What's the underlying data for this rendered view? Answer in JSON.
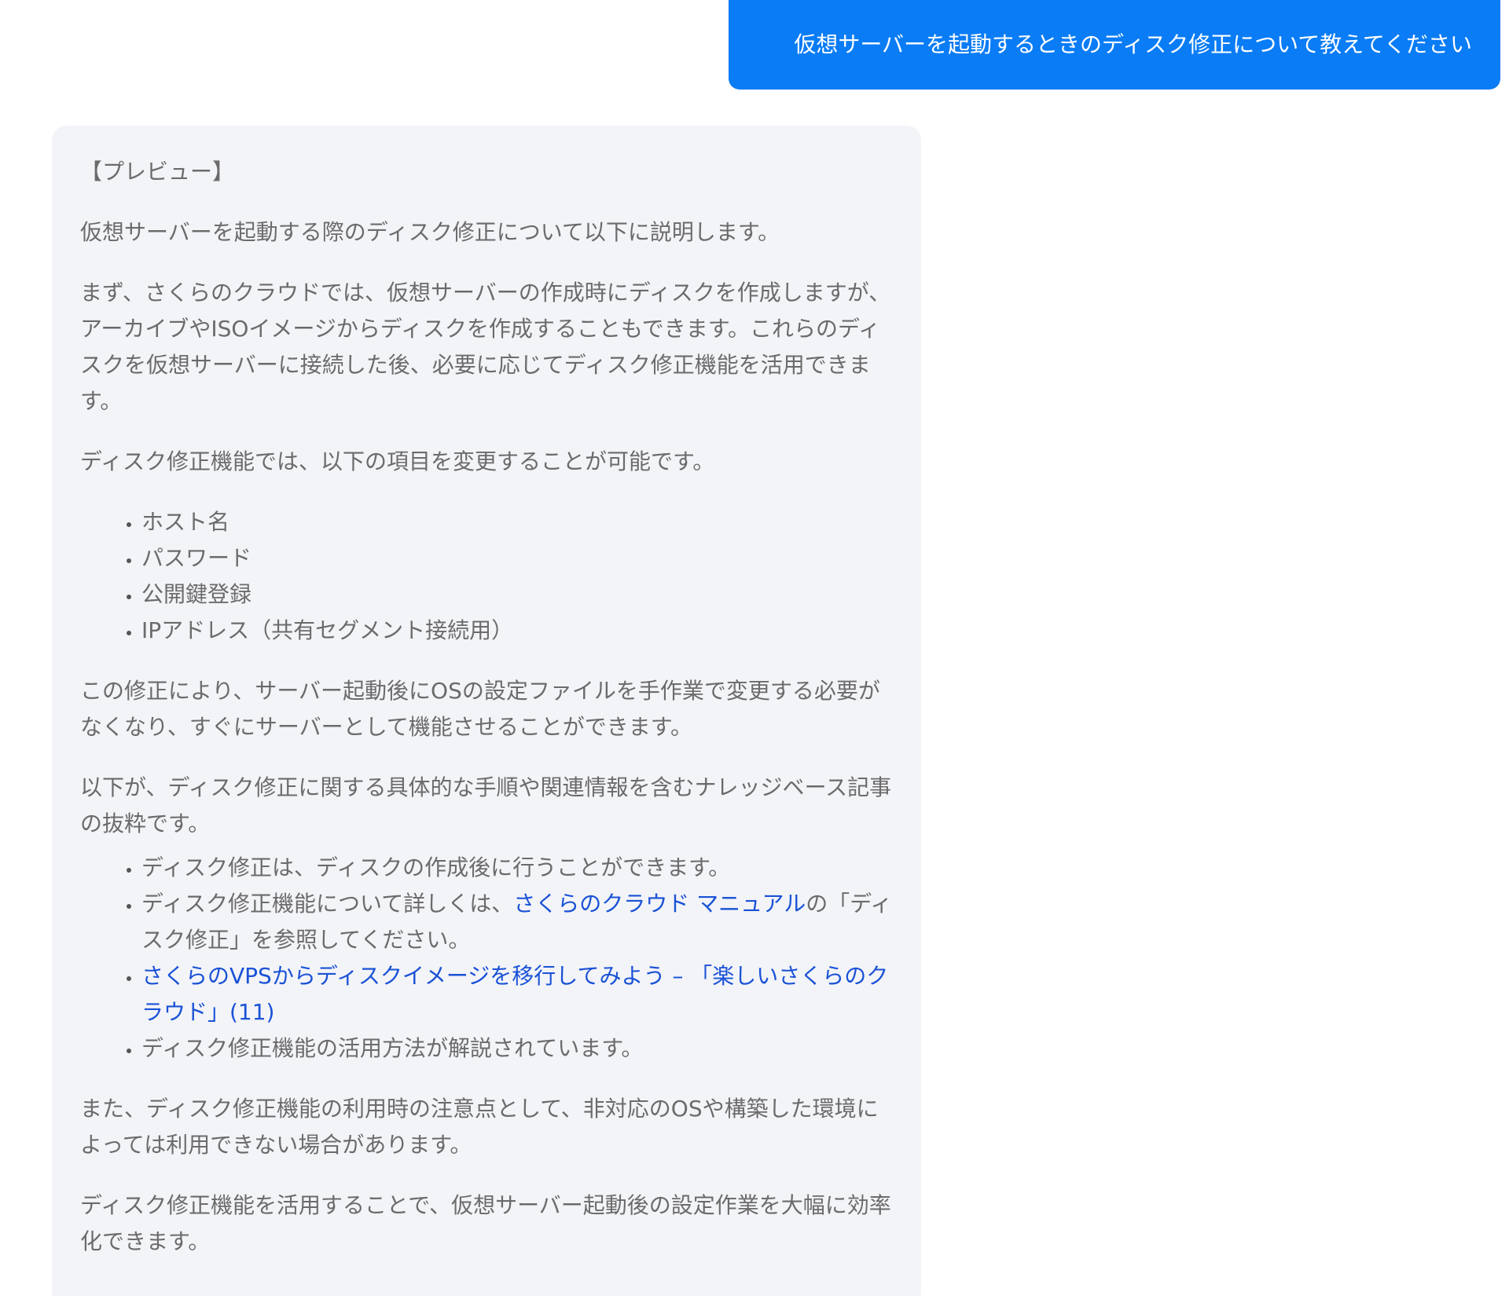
{
  "user_message": {
    "text": "仮想サーバーを起動するときのディスク修正について教えてください"
  },
  "assistant_message": {
    "preview_tag": "【プレビュー】",
    "intro": "仮想サーバーを起動する際のディスク修正について以下に説明します。",
    "paragraph_1": "まず、さくらのクラウドでは、仮想サーバーの作成時にディスクを作成しますが、アーカイブやISOイメージからディスクを作成することもできます。これらのディスクを仮想サーバーに接続した後、必要に応じてディスク修正機能を活用できます。",
    "paragraph_2": "ディスク修正機能では、以下の項目を変更することが可能です。",
    "editable_items": [
      "ホスト名",
      "パスワード",
      "公開鍵登録",
      "IPアドレス（共有セグメント接続用）"
    ],
    "paragraph_3": "この修正により、サーバー起動後にOSの設定ファイルを手作業で変更する必要がなくなり、すぐにサーバーとして機能させることができます。",
    "paragraph_4": "以下が、ディスク修正に関する具体的な手順や関連情報を含むナレッジベース記事の抜粋です。",
    "kb_items": {
      "item_1": "ディスク修正は、ディスクの作成後に行うことができます。",
      "item_2_prefix": "ディスク修正機能について詳しくは、",
      "item_2_link": "さくらのクラウド マニュアル",
      "item_2_suffix": "の「ディスク修正」を参照してください。",
      "item_3_link": "さくらのVPSからディスクイメージを移行してみよう – 「楽しいさくらのクラウド」(11)",
      "item_4": "ディスク修正機能の活用方法が解説されています。"
    },
    "paragraph_5": "また、ディスク修正機能の利用時の注意点として、非対応のOSや構築した環境によっては利用できない場合があります。",
    "paragraph_6": "ディスク修正機能を活用することで、仮想サーバー起動後の設定作業を大幅に効率化できます。"
  },
  "colors": {
    "user_bubble": "#0a7cf5",
    "assistant_bubble": "#f3f4f8",
    "body_text": "#6b6b6b",
    "link": "#1a52d6"
  }
}
